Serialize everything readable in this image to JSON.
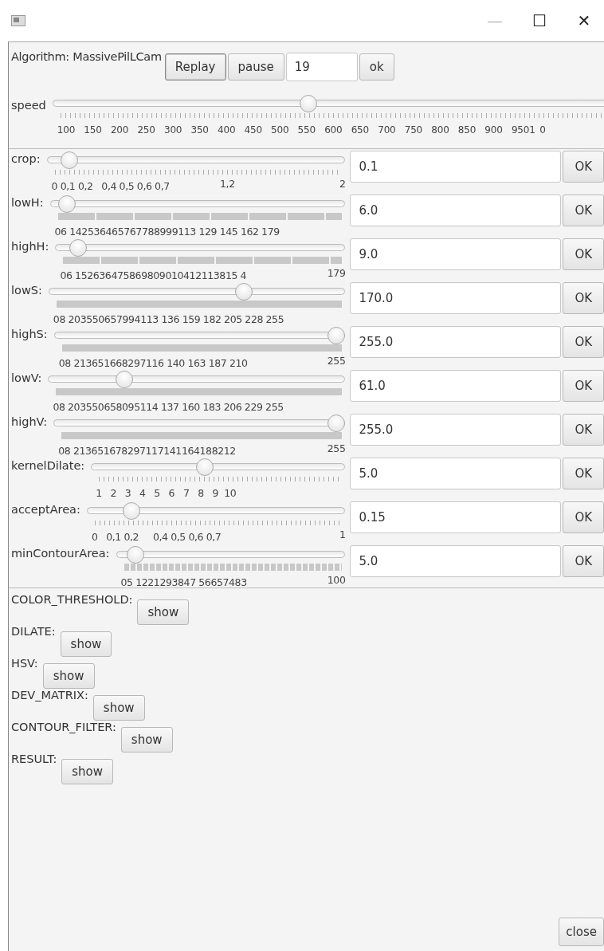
{
  "window": {
    "controls": [
      "—",
      "☐",
      "✕"
    ]
  },
  "toolbar": {
    "algorithm_label": "Algorithm: MassivePilLCam",
    "replay": "Replay",
    "pause": "pause",
    "frame": "19",
    "ok": "ok"
  },
  "speed": {
    "label": "speed",
    "level": 0.444,
    "tick_labels": "100  150  200  250  300  350  400  450  500  550  600  650  700  750  800  850  900  9501 0"
  },
  "sliders": [
    {
      "label": "crop:",
      "kind": "ticks",
      "level": 0.05,
      "tick_labels": "0 0,1 0,2   0,4 0,5 0,6 0,7",
      "tick_mid": "1,2",
      "tick_end": "2",
      "value": "0.1",
      "button": "OK"
    },
    {
      "label": "lowH:",
      "kind": "segmented",
      "level": 0.03,
      "tick_labels": "06 142536465767788999113 129 145 162 179",
      "value": "6.0",
      "button": "OK"
    },
    {
      "label": "highH:",
      "kind": "segmented",
      "level": 0.05,
      "tick_labels": "06 152636475869809010412113815 4",
      "tick_end": "179",
      "value": "9.0",
      "button": "OK"
    },
    {
      "label": "lowS:",
      "kind": "bar",
      "level": 0.667,
      "tick_labels": "08 203550657994113 136 159 182 205 228 255",
      "value": "170.0",
      "button": "OK"
    },
    {
      "label": "highS:",
      "kind": "bar",
      "level": 1,
      "tick_labels": "08 213651668297116 140 163 187 210",
      "tick_end": "255",
      "value": "255.0",
      "button": "OK"
    },
    {
      "label": "lowV:",
      "kind": "bar",
      "level": 0.24,
      "tick_labels": "08 203550658095114 137 160 183 206 229 255",
      "value": "61.0",
      "button": "OK"
    },
    {
      "label": "highV:",
      "kind": "bar",
      "level": 1,
      "tick_labels": "08 213651678297117141164188212",
      "tick_end": "255",
      "value": "255.0",
      "button": "OK"
    },
    {
      "label": "kernelDilate:",
      "kind": "ticks",
      "level": 0.444,
      "tick_labels": "1   2   3   4   5   6   7   8   9  10",
      "value": "5.0",
      "button": "OK"
    },
    {
      "label": "acceptArea:",
      "kind": "ticks",
      "level": 0.15,
      "tick_labels": "0   0,1 0,2     0,4 0,5 0,6 0,7",
      "tick_end": "1",
      "value": "0.15",
      "button": "OK"
    },
    {
      "label": "minContourArea:",
      "kind": "dashed",
      "level": 0.05,
      "tick_labels": "05 1221293847 56657483",
      "tick_end": "100",
      "value": "5.0",
      "button": "OK"
    }
  ],
  "views": [
    {
      "label": "COLOR_THRESHOLD:",
      "button": "show"
    },
    {
      "label": "DILATE:",
      "button": "show"
    },
    {
      "label": "HSV:",
      "button": "show"
    },
    {
      "label": "DEV_MATRIX:",
      "button": "show"
    },
    {
      "label": "CONTOUR_FILTER:",
      "button": "show"
    },
    {
      "label": "RESULT:",
      "button": "show"
    }
  ],
  "close": "close"
}
